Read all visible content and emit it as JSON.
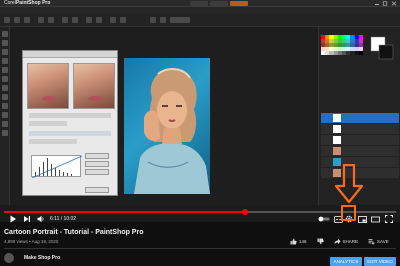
{
  "app": {
    "window_title_prefix": "Corel",
    "window_title_product": "PaintShop Pro"
  },
  "player": {
    "current_time": "6:11",
    "duration": "10:02",
    "time_separator": " / ",
    "progress_fraction": 0.615,
    "accent_color": "#ff0000"
  },
  "video": {
    "title": "Cartoon Portrait - Tutorial - PaintShop Pro",
    "meta": "4,899 views • Aug 19, 2020"
  },
  "actions": {
    "like_count": "146",
    "share_label": "SHARE",
    "save_label": "SAVE"
  },
  "channel": {
    "name": "Make Shop Pro",
    "analytics_label": "ANALYTICS",
    "edit_label": "EDIT VIDEO"
  },
  "annotation": {
    "highlight_color": "#ff6a1a"
  }
}
